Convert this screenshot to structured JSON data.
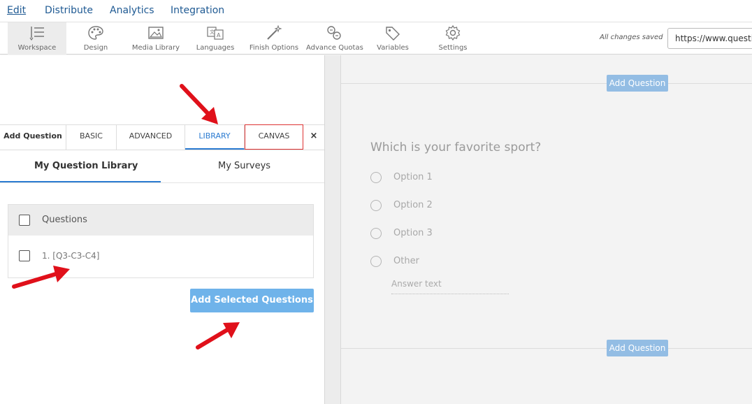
{
  "nav": {
    "items": [
      {
        "label": "Edit"
      },
      {
        "label": "Distribute"
      },
      {
        "label": "Analytics"
      },
      {
        "label": "Integration"
      }
    ]
  },
  "toolbar": {
    "tools": [
      {
        "label": "Workspace",
        "icon": "workspace-icon"
      },
      {
        "label": "Design",
        "icon": "palette-icon"
      },
      {
        "label": "Media Library",
        "icon": "image-icon"
      },
      {
        "label": "Languages",
        "icon": "language-icon"
      },
      {
        "label": "Finish Options",
        "icon": "magic-wand-icon"
      },
      {
        "label": "Advance Quotas",
        "icon": "quota-icon"
      },
      {
        "label": "Variables",
        "icon": "tag-icon"
      },
      {
        "label": "Settings",
        "icon": "gear-icon"
      }
    ],
    "saved_status": "All changes saved",
    "url_value": "https://www.questic"
  },
  "left_panel": {
    "tabs": {
      "add_question": "Add Question",
      "basic": "BASIC",
      "advanced": "ADVANCED",
      "library": "LIBRARY",
      "canvas": "CANVAS",
      "close": "×"
    },
    "subtabs": {
      "my_library": "My Question Library",
      "my_surveys": "My Surveys"
    },
    "table": {
      "header": "Questions",
      "rows": [
        "1. [Q3-C3-C4]"
      ]
    },
    "add_selected_label": "Add Selected Questions"
  },
  "canvas": {
    "add_question_label": "Add Question",
    "question_title": "Which is your favorite sport?",
    "options": [
      "Option 1",
      "Option 2",
      "Option 3",
      "Other"
    ],
    "answer_placeholder": "Answer text"
  },
  "colors": {
    "accent": "#2b7bd1",
    "button": "#6fb3ea",
    "add_question_button": "#93bde4",
    "arrow": "#e0101a"
  }
}
